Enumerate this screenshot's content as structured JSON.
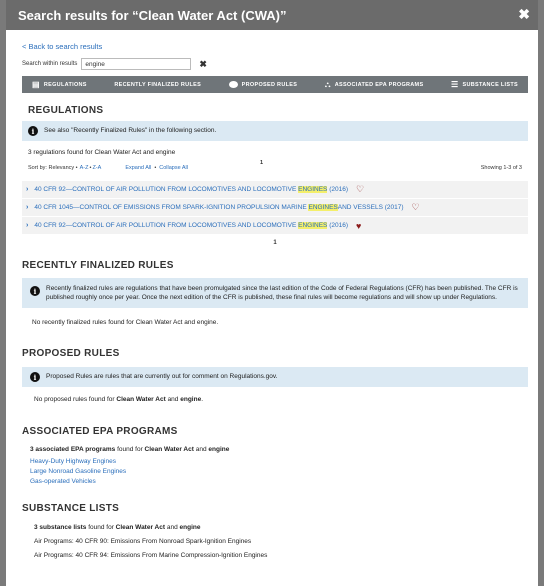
{
  "modal": {
    "title": "Search results for “Clean Water Act (CWA)”",
    "close": "✖"
  },
  "back_link": "< Back to search results",
  "search": {
    "label": "Search within results",
    "value": "engine",
    "clear": "✖"
  },
  "tabs": [
    {
      "label": "REGULATIONS",
      "icon": "book-icon",
      "glyph": "▤"
    },
    {
      "label": "RECENTLY FINALIZED RULES",
      "icon": "",
      "glyph": ""
    },
    {
      "label": "PROPOSED RULES",
      "icon": "speech-bubble-icon",
      "glyph": "💬"
    },
    {
      "label": "ASSOCIATED EPA PROGRAMS",
      "icon": "org-chart-icon",
      "glyph": "⛬"
    },
    {
      "label": "SUBSTANCE LISTS",
      "icon": "list-icon",
      "glyph": "☰"
    }
  ],
  "regulations": {
    "title": "REGULATIONS",
    "info": "See also \"Recently Finalized Rules\" in the following section.",
    "found": "3 regulations found for Clean Water Act and engine",
    "sort_label": "Sort by: Relevancy •",
    "sort_az": "A-Z",
    "sort_za": "Z-A",
    "expand": "Expand All",
    "collapse": "Collapse All",
    "page": "1",
    "showing": "Showing 1-3 of 3",
    "results": [
      {
        "pre": "40 CFR 92—CONTROL OF AIR POLLUTION FROM LOCOMOTIVES AND LOCOMOTIVE ",
        "hl": "ENGINES",
        "post": " (2016)",
        "heart": "♡",
        "heart_icon": "heart-outline-icon"
      },
      {
        "pre": "40 CFR 1045—CONTROL OF EMISSIONS FROM SPARK-IGNITION PROPULSION MARINE ",
        "hl": "ENGINES",
        "post": "AND VESSELS (2017)",
        "heart": "♡",
        "heart_icon": "heart-outline-icon"
      },
      {
        "pre": "40 CFR 92—CONTROL OF AIR POLLUTION FROM LOCOMOTIVES AND LOCOMOTIVE ",
        "hl": "ENGINES",
        "post": " (2016)",
        "heart": "♥",
        "heart_icon": "heart-filled-icon"
      }
    ],
    "page_bottom": "1"
  },
  "finalized": {
    "title": "RECENTLY FINALIZED RULES",
    "info": "Recently finalized rules are regulations that have been promulgated since the last edition of the Code of Federal Regulations (CFR) has been published. The CFR is published roughly once per year. Once the next edition of the CFR is published, these final rules will become regulations and will show up under Regulations.",
    "none": "No recently finalized rules found for Clean Water Act and engine."
  },
  "proposed": {
    "title": "PROPOSED RULES",
    "info": "Proposed Rules are rules that are currently out for comment on Regulations.gov.",
    "none_pre": "No proposed rules found for ",
    "none_b1": "Clean Water Act",
    "none_mid": " and ",
    "none_b2": "engine",
    "none_post": "."
  },
  "programs": {
    "title": "ASSOCIATED EPA PROGRAMS",
    "found_b": "3 associated EPA programs",
    "found_mid": " found for ",
    "found_b2": "Clean Water Act",
    "found_and": " and ",
    "found_b3": "engine",
    "items": [
      "Heavy-Duty Highway Engines",
      "Large Nonroad Gasoline Engines",
      "Gas-operated Vehicles"
    ]
  },
  "substances": {
    "title": "SUBSTANCE LISTS",
    "found_b": "3 substance lists",
    "found_mid": " found for ",
    "found_b2": "Clean Water Act",
    "found_and": " and ",
    "found_b3": "engine",
    "items": [
      "Air Programs: 40 CFR 90: Emissions From Nonroad Spark-Ignition Engines",
      "Air Programs: 40 CFR 94: Emissions From Marine Compression-Ignition Engines"
    ]
  },
  "colors": {
    "link": "#2a6ebb",
    "highlight": "#f4ef6b",
    "tabbar": "#6f7579",
    "infobox": "#dbe9f3",
    "heart": "#8b1a1a"
  }
}
